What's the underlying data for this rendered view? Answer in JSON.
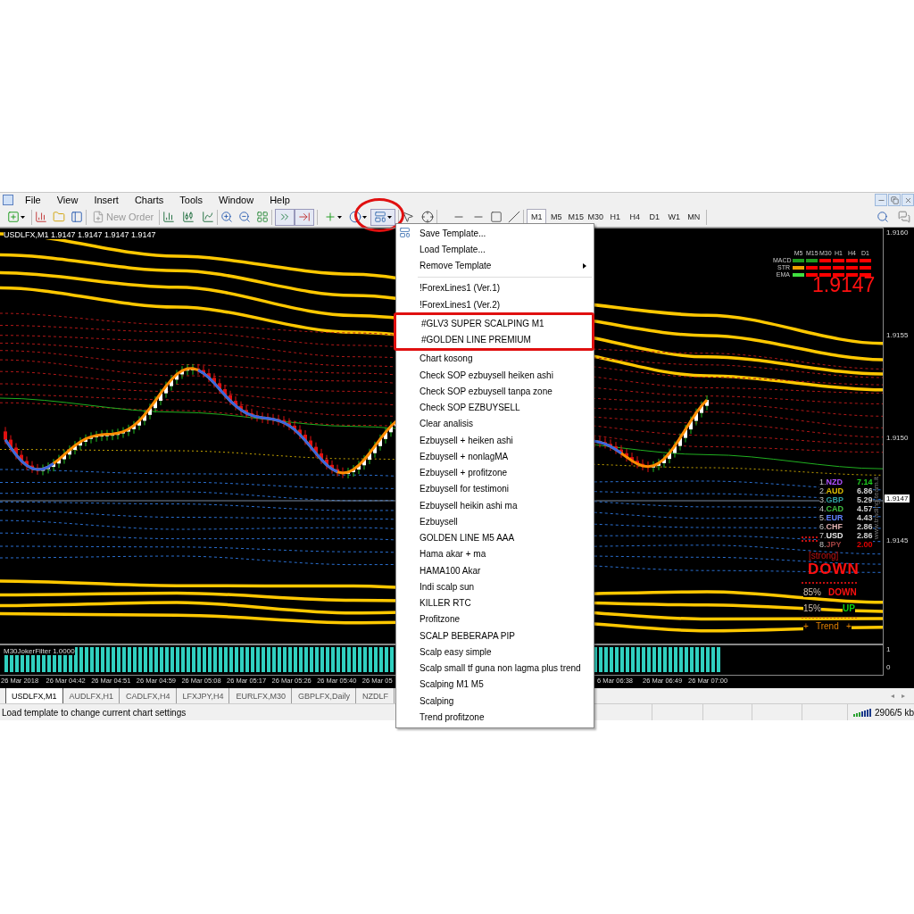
{
  "menu_bar": {
    "items": [
      "File",
      "View",
      "Insert",
      "Charts",
      "Tools",
      "Window",
      "Help"
    ]
  },
  "toolbar": {
    "new_order": {
      "label": "New Order",
      "disabled": true
    },
    "template_button": {
      "annotated": true
    },
    "timeframes": [
      {
        "label": "M1",
        "selected": true
      },
      {
        "label": "M5",
        "selected": false
      },
      {
        "label": "M15",
        "selected": false
      },
      {
        "label": "M30",
        "selected": false
      },
      {
        "label": "H1",
        "selected": false
      },
      {
        "label": "H4",
        "selected": false
      },
      {
        "label": "D1",
        "selected": false
      },
      {
        "label": "W1",
        "selected": false
      },
      {
        "label": "MN",
        "selected": false
      }
    ]
  },
  "chart": {
    "title": "USDLFX,M1  1.9147 1.9147 1.9147 1.9147",
    "price_axis": [
      "1.9160",
      "1.9155",
      "1.9150",
      "1.9145"
    ],
    "current_price": "1.9147",
    "signal_panel": {
      "columns": [
        "M5",
        "M15",
        "M30",
        "H1",
        "H4",
        "D1"
      ],
      "rows": [
        {
          "name": "MACD",
          "cells": [
            {
              "color": "#1e9a1e"
            },
            {
              "color": "#1e9a1e"
            },
            {
              "color": "#ff0000"
            },
            {
              "color": "#ff0000"
            },
            {
              "color": "#ff0000"
            },
            {
              "color": "#ff0000"
            }
          ]
        },
        {
          "name": "STR",
          "cells": [
            {
              "color": "#f0a000"
            },
            {
              "color": "#ff0000"
            },
            {
              "color": "#ff0000"
            },
            {
              "color": "#ff0000"
            },
            {
              "color": "#ff0000"
            },
            {
              "color": "#ff0000"
            }
          ]
        },
        {
          "name": "EMA",
          "cells": [
            {
              "color": "#40e040"
            },
            {
              "color": "#ff0000"
            },
            {
              "color": "#ff0000"
            },
            {
              "color": "#ff0000"
            },
            {
              "color": "#ff0000"
            },
            {
              "color": "#ff0000"
            }
          ]
        }
      ],
      "price": "1.9147"
    },
    "strength": {
      "items": [
        {
          "rank": "1.",
          "currency": "NZD",
          "color": "#b050ff",
          "value": {
            "text": "7.14",
            "color": "#20d020"
          }
        },
        {
          "rank": "2.",
          "currency": "AUD",
          "color": "#e0c000",
          "value": {
            "text": "6.86",
            "color": "#d0d0d0"
          }
        },
        {
          "rank": "3.",
          "currency": "GBP",
          "color": "#30a0a0",
          "value": {
            "text": "5.29",
            "color": "#d0d0d0"
          }
        },
        {
          "rank": "4.",
          "currency": "CAD",
          "color": "#40c040",
          "value": {
            "text": "4.57",
            "color": "#d0d0d0"
          }
        },
        {
          "rank": "5.",
          "currency": "EUR",
          "color": "#6080ff",
          "value": {
            "text": "4.43",
            "color": "#d0d0d0"
          }
        },
        {
          "rank": "6.",
          "currency": "CHF",
          "color": "#e0b0b0",
          "value": {
            "text": "2.86",
            "color": "#d0d0d0"
          }
        },
        {
          "rank": "7.",
          "currency": "USD",
          "color": "#e8e8e8",
          "value": {
            "text": "2.86",
            "color": "#d0d0d0"
          }
        },
        {
          "rank": "8.",
          "currency": "JPY",
          "color": "#a04040",
          "value": {
            "text": "2.00",
            "color": "#e00000"
          }
        }
      ],
      "strength": "[strong]",
      "direction": "DOWN",
      "stats": [
        {
          "percent": "85%",
          "label": "DOWN",
          "color": "#ff1010"
        },
        {
          "percent": "15%",
          "label": "UP",
          "color": "#10d010"
        }
      ],
      "trend": "+   Trend   +"
    },
    "site_label": "www.trading-team.it"
  },
  "indicator": {
    "label": "M30JokerFilter 1.0000",
    "axis": [
      "1",
      "0"
    ]
  },
  "time_axis": {
    "labels": [
      "26 Mar 2018",
      "26 Mar 04:42",
      "26 Mar 04:51",
      "26 Mar 04:59",
      "26 Mar 05:08",
      "26 Mar 05:17",
      "26 Mar 05:26",
      "26 Mar 05:40",
      "26 Mar 05",
      "6 Mar 06:38",
      "26 Mar 06:49",
      "26 Mar 07:00"
    ]
  },
  "tabs": [
    {
      "label": "USDLFX,M1",
      "selected": true
    },
    {
      "label": "AUDLFX,H1",
      "selected": false
    },
    {
      "label": "CADLFX,H4",
      "selected": false
    },
    {
      "label": "LFXJPY,H4",
      "selected": false
    },
    {
      "label": "EURLFX,M30",
      "selected": false
    },
    {
      "label": "GBPLFX,Daily",
      "selected": false
    },
    {
      "label": "NZDLF",
      "selected": false
    }
  ],
  "tab_scroll": {
    "left": "◂",
    "right": "▸"
  },
  "status_bar": {
    "message": "Load template to change current chart settings",
    "traffic": "2906/5 kb"
  },
  "template_menu": {
    "items": [
      {
        "kind": "icon",
        "label": "Save Template...",
        "annotated": false
      },
      {
        "kind": "item",
        "label": "Load Template...",
        "annotated": false
      },
      {
        "kind": "submenu",
        "label": "Remove Template",
        "annotated": false
      },
      {
        "kind": "separator"
      },
      {
        "kind": "item",
        "label": "!ForexLines1 (Ver.1)",
        "annotated": false
      },
      {
        "kind": "item",
        "label": "!ForexLines1 (Ver.2)",
        "annotated": false
      },
      {
        "kind": "item",
        "label": "#GLV3 SUPER SCALPING M1",
        "annotated": true
      },
      {
        "kind": "item",
        "label": "#GOLDEN LINE PREMIUM",
        "annotated": true
      },
      {
        "kind": "item",
        "label": "Chart kosong",
        "annotated": false
      },
      {
        "kind": "item",
        "label": "Check SOP ezbuysell heiken ashi",
        "annotated": false
      },
      {
        "kind": "item",
        "label": "Check SOP ezbuysell tanpa zone",
        "annotated": false
      },
      {
        "kind": "item",
        "label": "Check SOP EZBUYSELL",
        "annotated": false
      },
      {
        "kind": "item",
        "label": "Clear analisis",
        "annotated": false
      },
      {
        "kind": "item",
        "label": "Ezbuysell + heiken ashi",
        "annotated": false
      },
      {
        "kind": "item",
        "label": "Ezbuysell + nonlagMA",
        "annotated": false
      },
      {
        "kind": "item",
        "label": "Ezbuysell + profitzone",
        "annotated": false
      },
      {
        "kind": "item",
        "label": "Ezbuysell for testimoni",
        "annotated": false
      },
      {
        "kind": "item",
        "label": "Ezbuysell heikin ashi ma",
        "annotated": false
      },
      {
        "kind": "item",
        "label": "Ezbuysell",
        "annotated": false
      },
      {
        "kind": "item",
        "label": "GOLDEN LINE M5 AAA",
        "annotated": false
      },
      {
        "kind": "item",
        "label": "Hama akar + ma",
        "annotated": false
      },
      {
        "kind": "item",
        "label": "HAMA100 Akar",
        "annotated": false
      },
      {
        "kind": "item",
        "label": "Indi scalp sun",
        "annotated": false
      },
      {
        "kind": "item",
        "label": "KILLER RTC",
        "annotated": false
      },
      {
        "kind": "item",
        "label": "Profitzone",
        "annotated": false
      },
      {
        "kind": "item",
        "label": "SCALP BEBERAPA PIP",
        "annotated": false
      },
      {
        "kind": "item",
        "label": "Scalp easy simple",
        "annotated": false
      },
      {
        "kind": "item",
        "label": "Scalp small tf guna  non lagma plus trend",
        "annotated": false
      },
      {
        "kind": "item",
        "label": "Scalping M1 M5",
        "annotated": false
      },
      {
        "kind": "item",
        "label": "Scalping",
        "annotated": false
      },
      {
        "kind": "item",
        "label": "Trend profitzone",
        "annotated": false
      }
    ]
  }
}
